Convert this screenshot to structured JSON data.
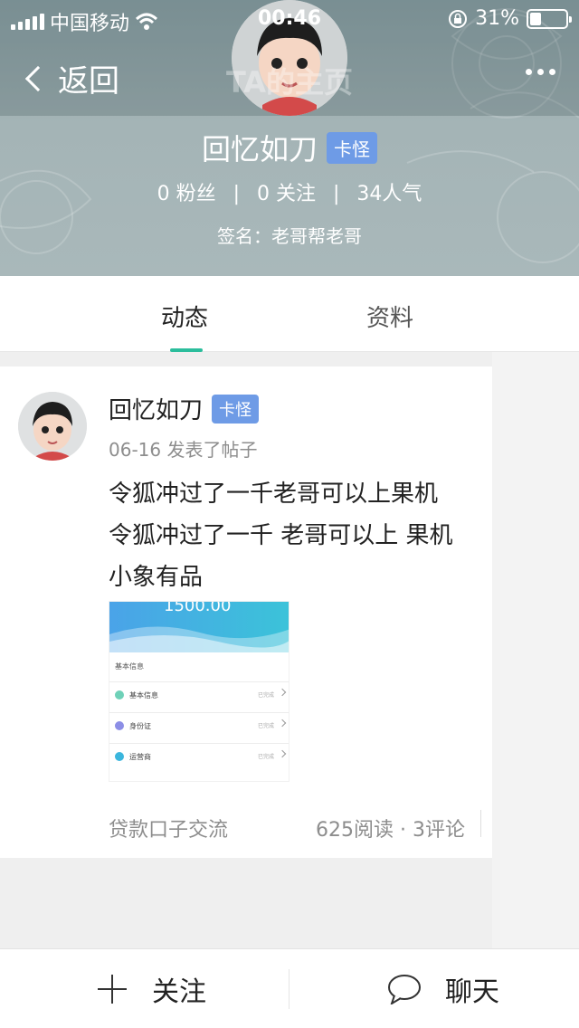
{
  "status_bar": {
    "carrier": "中国移动",
    "time": "00:46",
    "battery": "31%"
  },
  "navbar": {
    "back_label": "返回",
    "title": "TA的主页"
  },
  "profile": {
    "name": "回忆如刀",
    "badge": "卡怪",
    "fans": "0 粉丝",
    "following": "0 关注",
    "popularity": "34人气",
    "sep": "|",
    "signature": "签名：老哥帮老哥"
  },
  "tabs": [
    {
      "label": "动态",
      "active": true
    },
    {
      "label": "资料",
      "active": false
    }
  ],
  "post": {
    "author": "回忆如刀",
    "badge": "卡怪",
    "meta": "06-16 发表了帖子",
    "lines": [
      "令狐冲过了一千老哥可以上果机",
      "令狐冲过了一千 老哥可以上 果机",
      "小象有品"
    ],
    "thumbnail": {
      "amount": "1500.00",
      "section": "基本信息",
      "rows": [
        {
          "label": "基本信息",
          "status": "已完成",
          "color": "#6fd1b8"
        },
        {
          "label": "身份证",
          "status": "已完成",
          "color": "#8c8ee6"
        },
        {
          "label": "运营商",
          "status": "已完成",
          "color": "#3bb6dd"
        }
      ]
    },
    "category": "贷款口子交流",
    "stats": "625阅读 · 3评论"
  },
  "bottom_bar": {
    "follow": "关注",
    "chat": "聊天"
  },
  "colors": {
    "accent": "#2bbd9c",
    "badge": "#6e9be6"
  }
}
